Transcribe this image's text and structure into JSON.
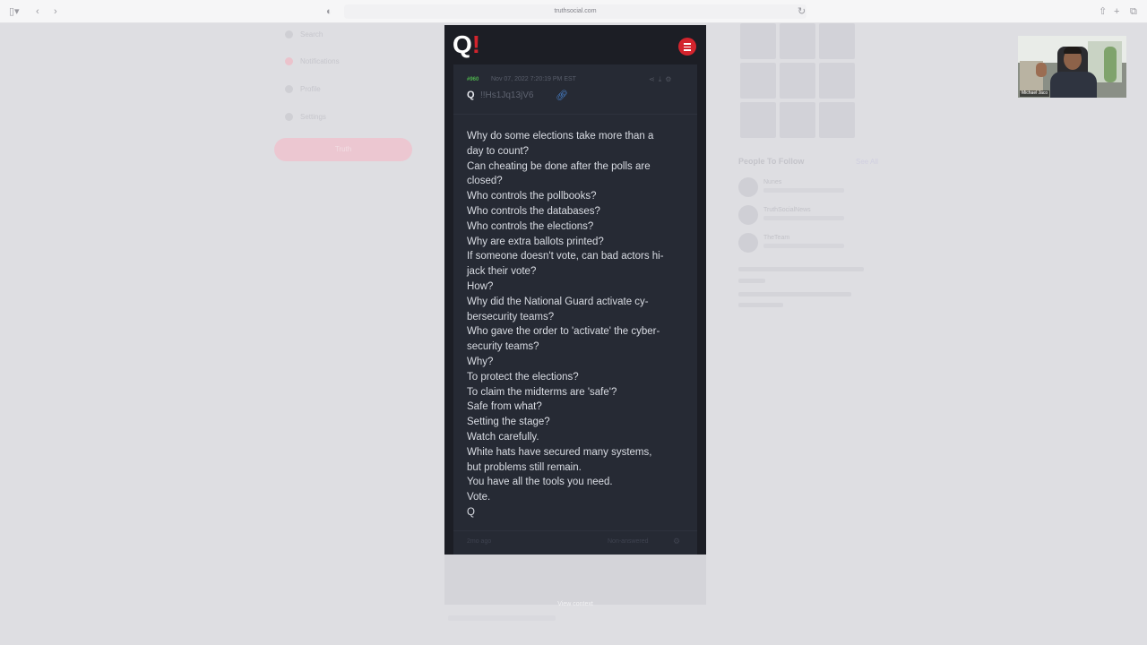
{
  "browser": {
    "url": "truthsocial.com"
  },
  "post": {
    "number": "#960",
    "date": "Nov 07, 2022 7:20:19 PM EST",
    "author": "Q",
    "tripcode": "!!Hs1Jq13jV6",
    "body_lines": [
      "Why do some elections take more than a",
      "day to count?",
      "Can cheating be done after the polls are",
      "closed?",
      "Who controls the pollbooks?",
      "Who controls the databases?",
      "Who controls the elections?",
      "Why are extra ballots printed?",
      "If someone doesn't vote, can bad actors hi-",
      "jack their vote?",
      "How?",
      "Why did the National Guard activate cy-",
      "bersecurity teams?",
      "Who gave the order to 'activate' the cyber-",
      "security teams?",
      "Why?",
      "To protect the elections?",
      "To claim the midterms are 'safe'?",
      "Safe from what?",
      "Setting the stage?",
      "Watch carefully.",
      "White hats have secured many systems,",
      "but problems still remain.",
      "You have all the tools you need.",
      "Vote.",
      "Q"
    ],
    "footer_left": "2mo ago",
    "footer_right": "Non-answered"
  },
  "background": {
    "left_nav": [
      "Search",
      "Notifications",
      "Profile",
      "Settings"
    ],
    "left_button": "Truth",
    "people_to_follow_title": "People To Follow",
    "people_to_follow_see_all": "See All",
    "people": [
      "Nunes",
      "TruthSocialNews",
      "TheTeam"
    ],
    "under_phone_text": "View context"
  },
  "webcam": {
    "label": "Michael Jaco"
  },
  "colors": {
    "brand_red": "#d3242d",
    "post_number_green": "#4cae4c",
    "link_blue": "#4a88d8",
    "phone_bg": "#1c1e25",
    "post_bg": "#262a34"
  }
}
